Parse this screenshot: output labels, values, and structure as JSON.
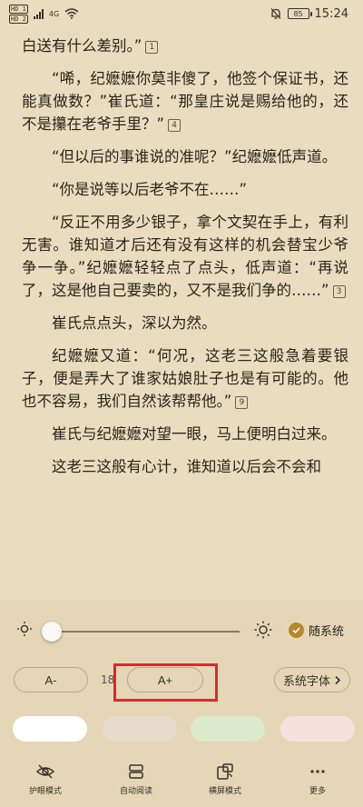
{
  "status_bar": {
    "sim1": "HD 1",
    "sim2": "HD 2",
    "network": "4G",
    "battery": "85",
    "time": "15:24"
  },
  "reader": {
    "paragraphs": [
      {
        "text": "白送有什么差别。”",
        "note": "1"
      },
      {
        "text": "“唏，纪嬷嬷你莫非傻了，他签个保证书，还能真做数？”崔氏道：“那皇庄说是赐给他的，还不是攥在老爷手里？”",
        "note": "4"
      },
      {
        "text": "“但以后的事谁说的准呢？”纪嬷嬷低声道。",
        "note": ""
      },
      {
        "text": "“你是说等以后老爷不在……”",
        "note": ""
      },
      {
        "text": "“反正不用多少银子，拿个文契在手上，有利无害。谁知道才后还有没有这样的机会替宝少爷争一争。”纪嬷嬷轻轻点了点头，低声道：“再说了，这是他自己要卖的，又不是我们争的……”",
        "note": "3"
      },
      {
        "text": "崔氏点点头，深以为然。",
        "note": ""
      },
      {
        "text": "纪嬷嬷又道：“何况，这老三这般急着要银子，便是弄大了谁家姑娘肚子也是有可能的。他也不容易，我们自然该帮帮他。”",
        "note": "9"
      },
      {
        "text": "崔氏与纪嬷嬷对望一眼，马上便明白过来。",
        "note": ""
      },
      {
        "text": "这老三这般有心计，谁知道以后会不会和",
        "note": ""
      }
    ]
  },
  "settings": {
    "brightness_level": 0.05,
    "follow_system_label": "随系统",
    "decrease_font_label": "A-",
    "font_size": "18",
    "increase_font_label": "A+",
    "font_face_label": "系统字体",
    "themes": [
      "#ffffff",
      "#e7dbca",
      "#dce9ca",
      "#f7e0dc"
    ]
  },
  "bottom_nav": {
    "items": [
      "护眼模式",
      "自动阅读",
      "横屏模式",
      "更多"
    ]
  },
  "colors": {
    "page_background": "#e9dcbf",
    "panel_background": "#e4d6b7",
    "accent": "#b8862b",
    "highlight": "#e1262c"
  }
}
